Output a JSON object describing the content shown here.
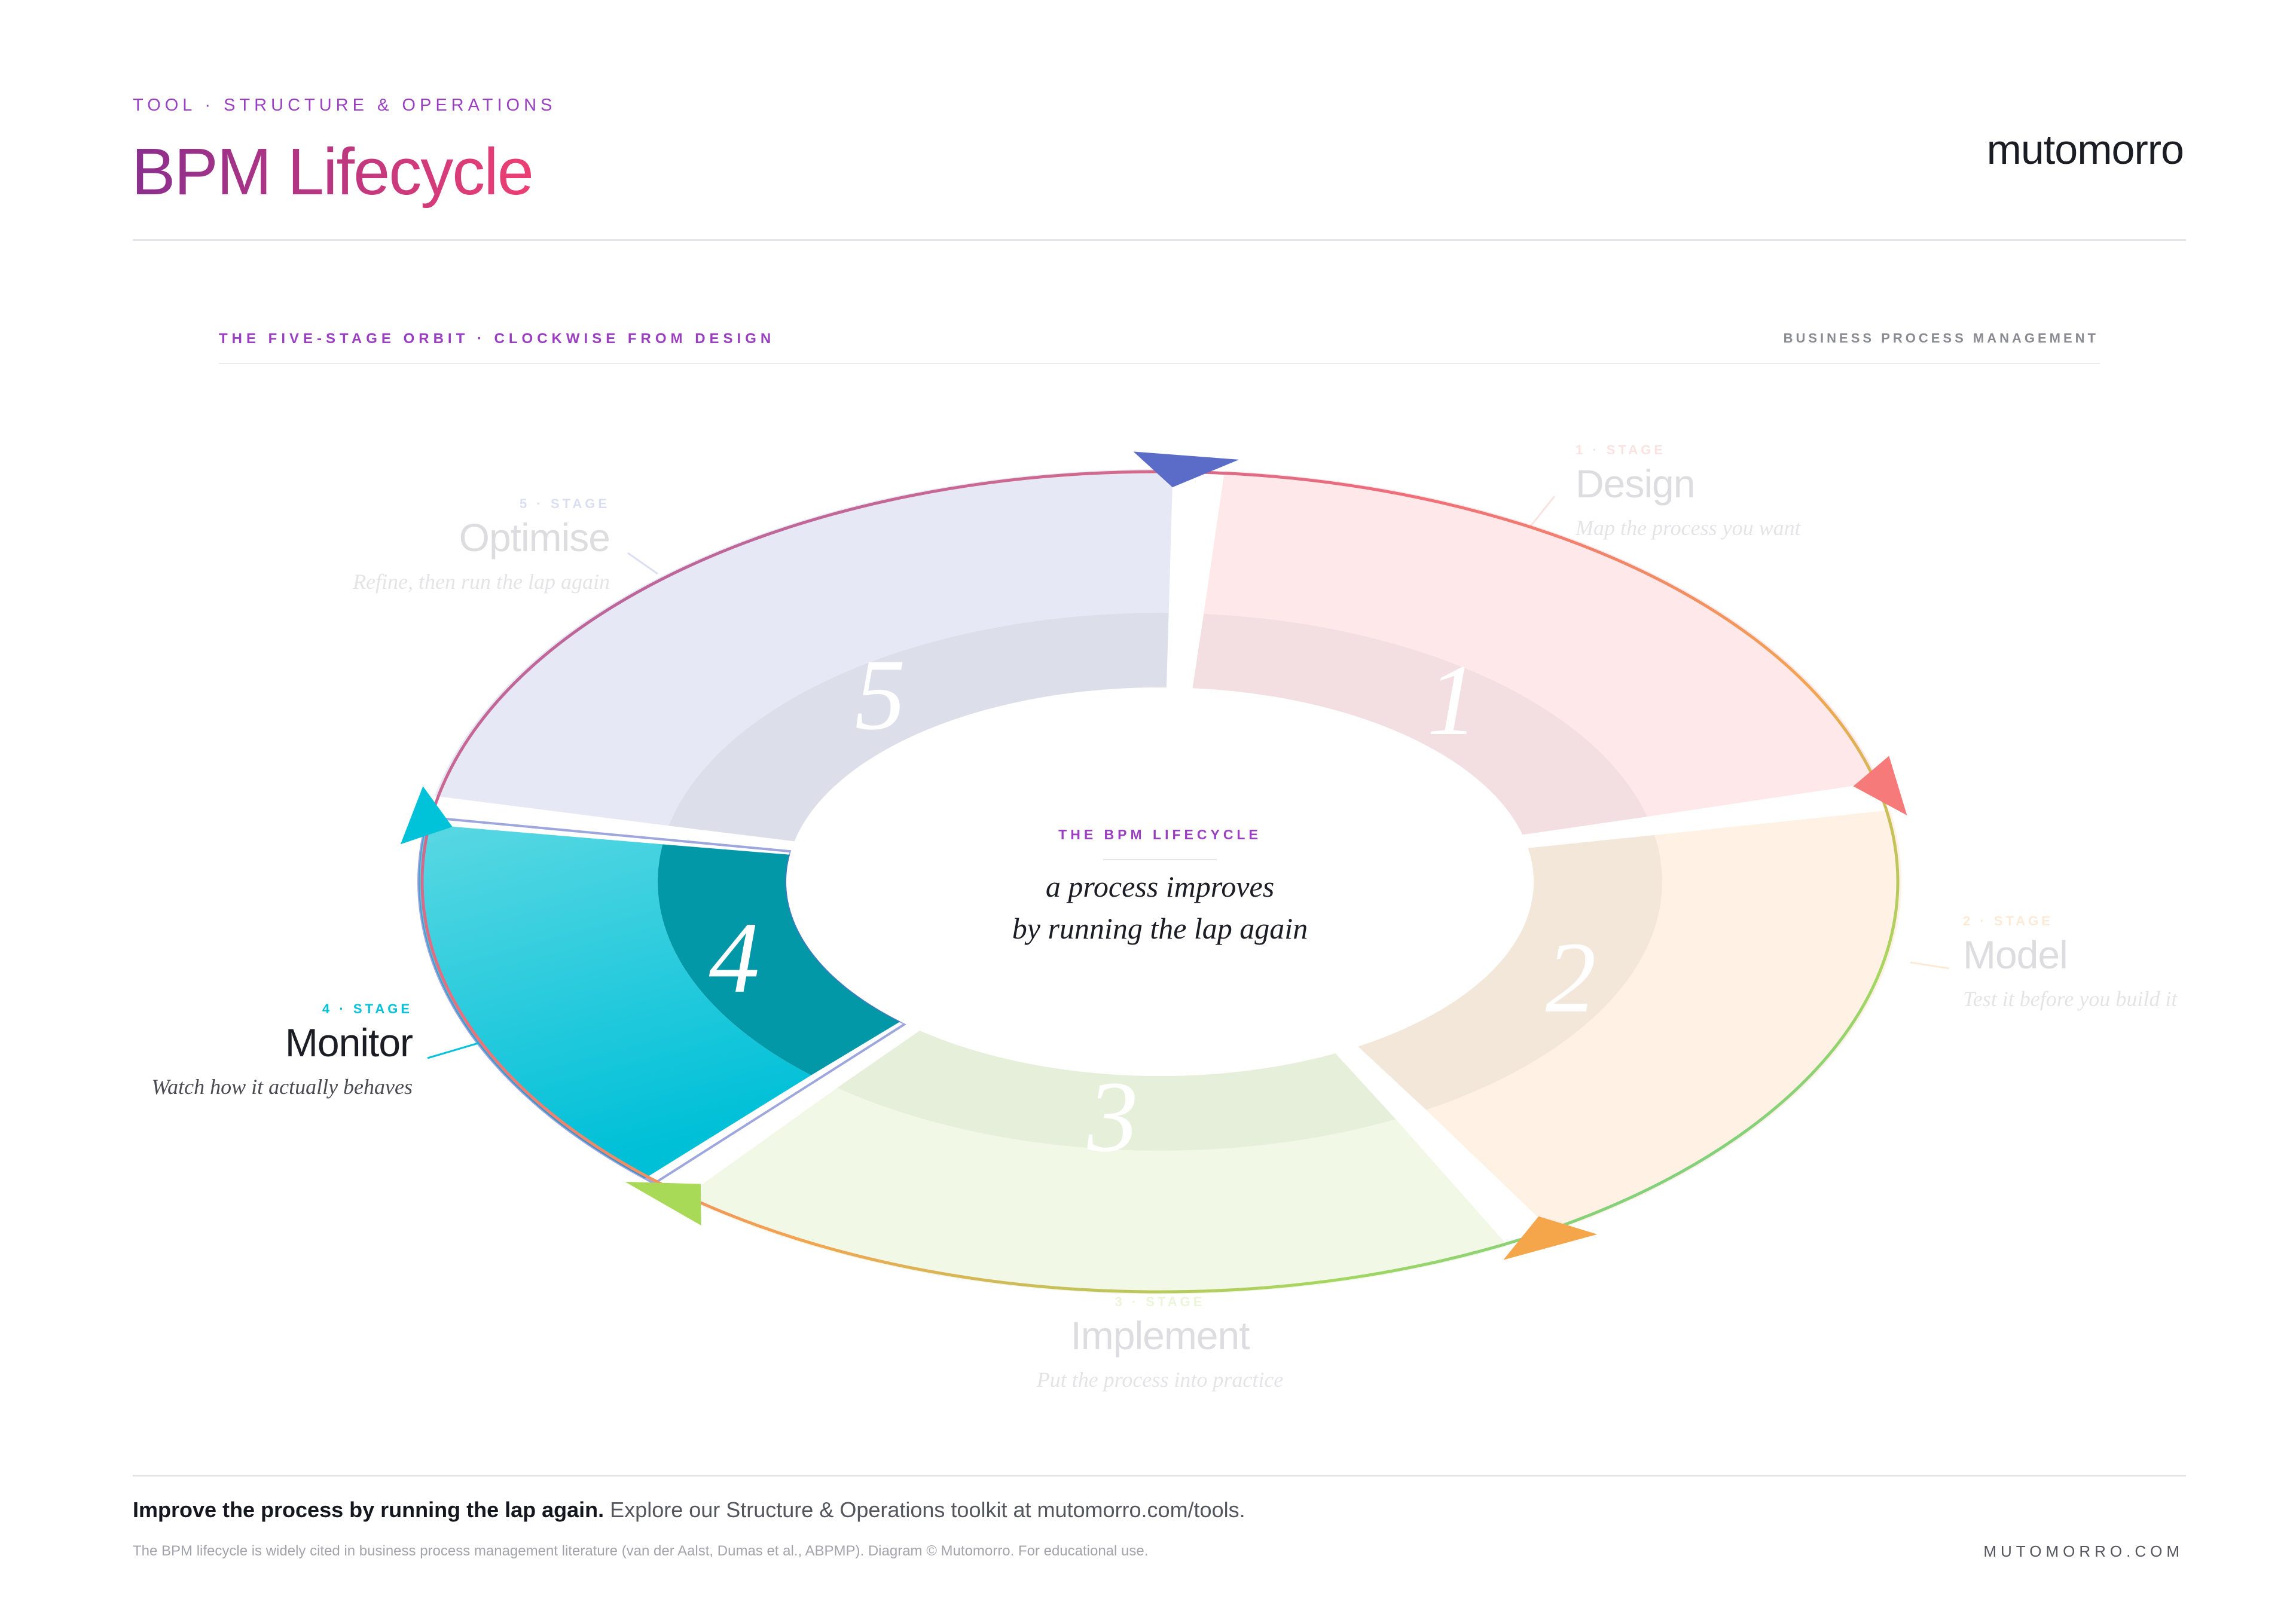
{
  "header": {
    "kicker": "TOOL · STRUCTURE & OPERATIONS",
    "title": "BPM Lifecycle",
    "brand": "mutomorro"
  },
  "diagram_header": {
    "left": "THE FIVE-STAGE ORBIT · CLOCKWISE FROM DESIGN",
    "right": "BUSINESS PROCESS MANAGEMENT"
  },
  "center": {
    "label": "THE BPM LIFECYCLE",
    "line1": "a process improves",
    "line2": "by running the lap again"
  },
  "stages": [
    {
      "id": "design",
      "numeral": "1",
      "kicker": "1 · STAGE",
      "name": "Design",
      "desc": "Map the process you want",
      "color": "#f67a7a",
      "active": false
    },
    {
      "id": "model",
      "numeral": "2",
      "kicker": "2 · STAGE",
      "name": "Model",
      "desc": "Test it before you build it",
      "color": "#f5a54a",
      "active": false
    },
    {
      "id": "implement",
      "numeral": "3",
      "kicker": "3 · STAGE",
      "name": "Implement",
      "desc": "Put the process into practice",
      "color": "#a8d957",
      "active": false
    },
    {
      "id": "monitor",
      "numeral": "4",
      "kicker": "4 · STAGE",
      "name": "Monitor",
      "desc": "Watch how it actually behaves",
      "color": "#00c2d9",
      "active": true
    },
    {
      "id": "optimise",
      "numeral": "5",
      "kicker": "5 · STAGE",
      "name": "Optimise",
      "desc": "Refine, then run the lap again",
      "color": "#5b6cc8",
      "active": false
    }
  ],
  "footer": {
    "lead": "Improve the process by running the lap again.",
    "rest": " Explore our Structure & Operations toolkit at mutomorro.com/tools.",
    "note": "The BPM lifecycle is widely cited in business process management literature (van der Aalst, Dumas et al., ABPMP). Diagram © Mutomorro. For educational use.",
    "url": "MUTOMORRO.COM"
  }
}
